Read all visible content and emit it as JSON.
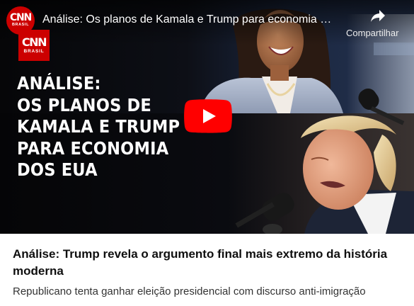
{
  "video": {
    "title": "Análise: Os planos de Kamala e Trump para economia dos EUA",
    "channel": {
      "logo_text": "CNN",
      "logo_subtext": "BRASIL"
    },
    "share_label": "Compartilhar",
    "thumbnail": {
      "logo_text": "CNN",
      "logo_subtext": "BRASIL",
      "headline_lines": [
        "ANÁLISE:",
        "OS PLANOS DE",
        "KAMALA E TRUMP",
        "PARA ECONOMIA",
        "DOS EUA"
      ]
    }
  },
  "article": {
    "title": "Análise: Trump revela o argumento final mais extremo da história moderna",
    "subtitle": "Republicano tenta ganhar eleição presidencial com discurso anti-imigração"
  },
  "colors": {
    "brand_red": "#cc0000",
    "youtube_red": "#ff0000",
    "title_text": "#0f0f0f",
    "subtitle_text": "#333333"
  },
  "icons": {
    "share": "share-arrow-icon",
    "play": "youtube-play-icon"
  }
}
